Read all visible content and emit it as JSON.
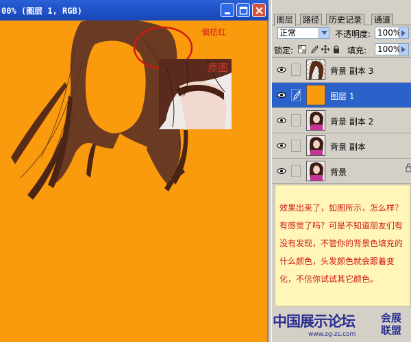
{
  "document": {
    "title": "00% (图层 1, RGB)",
    "background_color": "#fa9a0d",
    "annotation_hue": "偏桔红",
    "annotation_original": "原图",
    "window_buttons": [
      "minimize-icon",
      "maximize-icon",
      "close-icon"
    ]
  },
  "panel": {
    "tabs": [
      "图层",
      "路径",
      "历史记录",
      "通道"
    ],
    "active_tab": "图层",
    "blend_mode": "正常",
    "opacity_label": "不透明度:",
    "opacity_value": "100%",
    "lock_label": "锁定:",
    "fill_label": "填充:",
    "fill_value": "100%",
    "lock_icons": [
      "lock-transparent-icon",
      "lock-brush-icon",
      "lock-move-icon",
      "lock-all-icon"
    ],
    "layers": [
      {
        "name": "背景 副本 3",
        "visible": true,
        "selected": false,
        "thumb": "transparent-hair"
      },
      {
        "name": "图层 1",
        "visible": true,
        "selected": true,
        "thumb": "orange-fill"
      },
      {
        "name": "背景 副本 2",
        "visible": true,
        "selected": false,
        "thumb": "portrait"
      },
      {
        "name": "背景 副本",
        "visible": true,
        "selected": false,
        "thumb": "portrait"
      },
      {
        "name": "背景",
        "visible": true,
        "selected": false,
        "thumb": "portrait"
      }
    ]
  },
  "note": {
    "text": "效果出来了，如图所示，怎么样？有感觉了吗？可是不知道朋友们有没有发现，不管你的背景色填充的什么颜色，头发颜色就会跟着变化，不信你试试其它颜色。"
  },
  "watermark": {
    "main": "中国展示论坛",
    "side": "会展联盟",
    "url": "www.zg-zs.com"
  },
  "colors": {
    "accent_selected": "#2a62c9",
    "annotation_red": "#d6211a",
    "canvas_orange": "#fa9a0d",
    "note_text": "#d01818"
  }
}
